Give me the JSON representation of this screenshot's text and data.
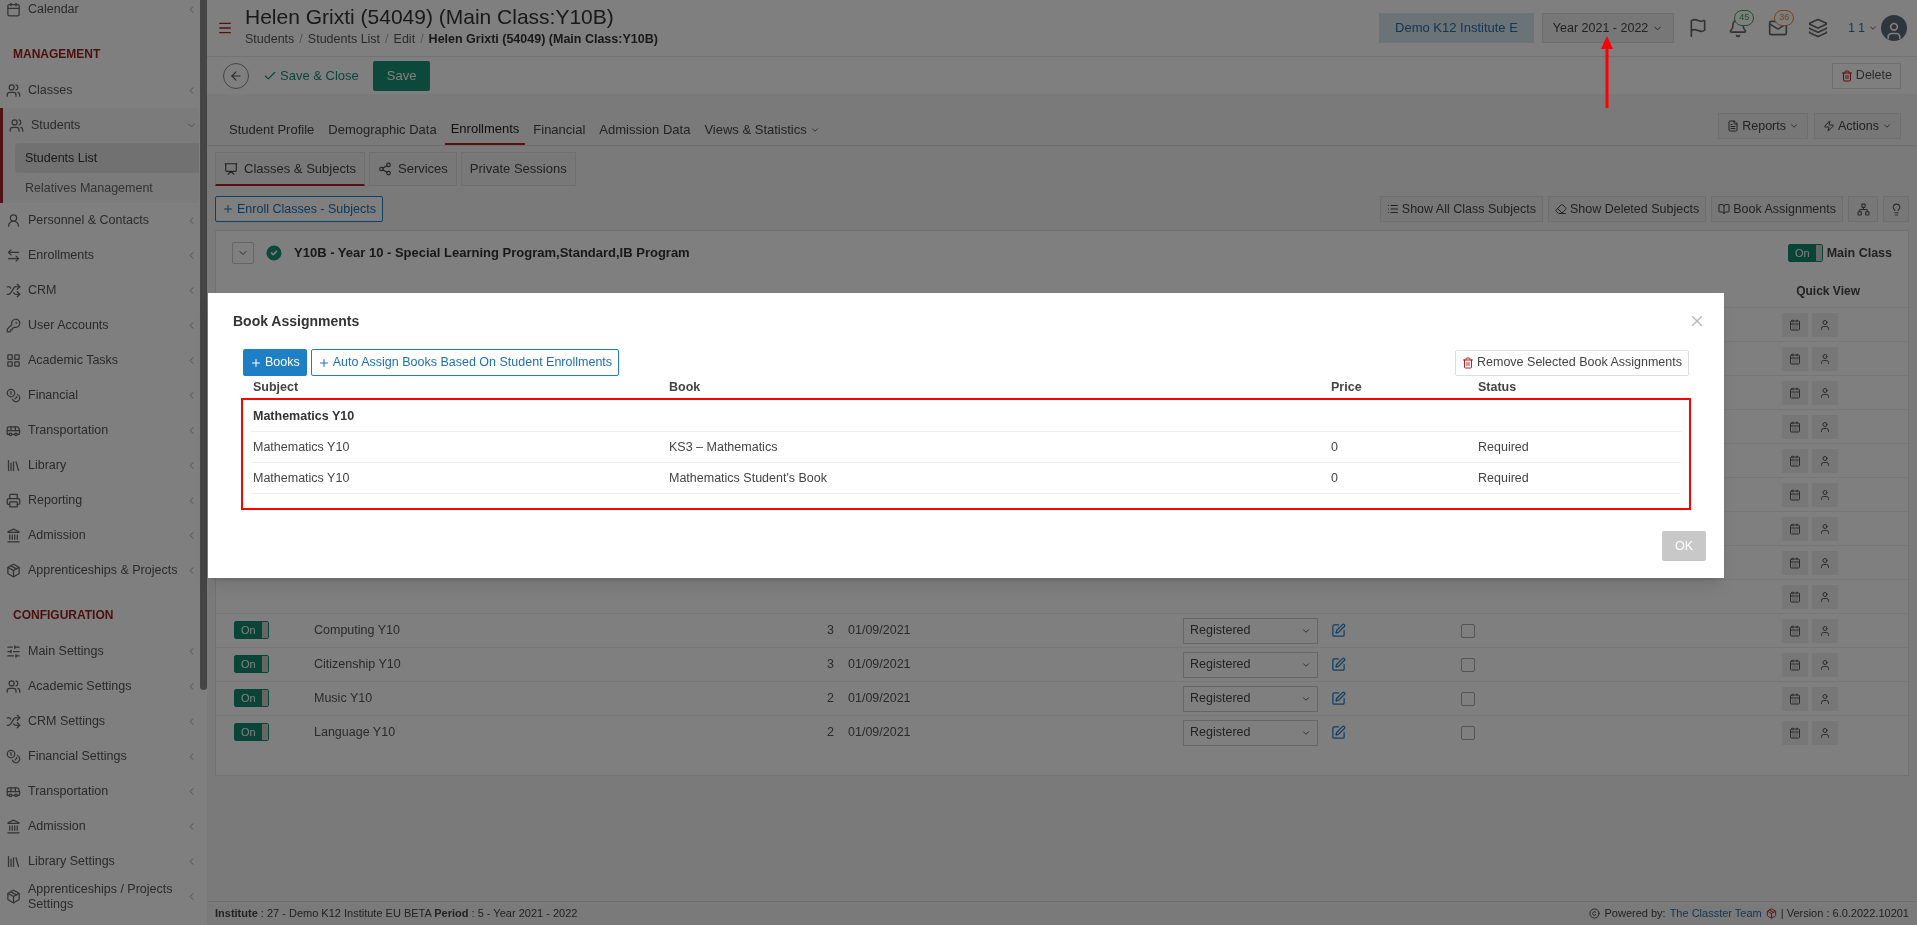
{
  "sidebar": {
    "items": [
      {
        "kind": "item",
        "label": "Calendar",
        "expanded": false
      },
      {
        "kind": "section",
        "label": "MANAGEMENT"
      },
      {
        "kind": "item",
        "label": "Classes",
        "expanded": false
      },
      {
        "kind": "item",
        "label": "Students",
        "expanded": true,
        "children": [
          {
            "label": "Students List",
            "selected": true
          },
          {
            "label": "Relatives Management",
            "selected": false
          }
        ]
      },
      {
        "kind": "item",
        "label": "Personnel & Contacts",
        "expanded": false
      },
      {
        "kind": "item",
        "label": "Enrollments",
        "expanded": false
      },
      {
        "kind": "item",
        "label": "CRM",
        "expanded": false
      },
      {
        "kind": "item",
        "label": "User Accounts",
        "expanded": false
      },
      {
        "kind": "item",
        "label": "Academic Tasks",
        "expanded": false
      },
      {
        "kind": "item",
        "label": "Financial",
        "expanded": false
      },
      {
        "kind": "item",
        "label": "Transportation",
        "expanded": false
      },
      {
        "kind": "item",
        "label": "Library",
        "expanded": false
      },
      {
        "kind": "item",
        "label": "Reporting",
        "expanded": false
      },
      {
        "kind": "item",
        "label": "Admission",
        "expanded": false
      },
      {
        "kind": "item",
        "label": "Apprenticeships & Projects",
        "expanded": false
      },
      {
        "kind": "section",
        "label": "CONFIGURATION"
      },
      {
        "kind": "item",
        "label": "Main Settings",
        "expanded": false
      },
      {
        "kind": "item",
        "label": "Academic Settings",
        "expanded": false
      },
      {
        "kind": "item",
        "label": "CRM Settings",
        "expanded": false
      },
      {
        "kind": "item",
        "label": "Financial Settings",
        "expanded": false
      },
      {
        "kind": "item",
        "label": "Transportation",
        "expanded": false
      },
      {
        "kind": "item",
        "label": "Admission",
        "expanded": false
      },
      {
        "kind": "item",
        "label": "Library Settings",
        "expanded": false
      },
      {
        "kind": "item",
        "label": "Apprenticeships / Projects Settings",
        "expanded": false
      }
    ]
  },
  "header": {
    "title": "Helen Grixti (54049) (Main Class:Y10B)",
    "breadcrumb_separator": "/",
    "breadcrumb": [
      {
        "label": "Students",
        "current": false
      },
      {
        "label": "Students List",
        "current": false
      },
      {
        "label": "Edit",
        "current": false
      },
      {
        "label": "Helen Grixti (54049) (Main Class:Y10B)",
        "current": true
      }
    ],
    "institute": "Demo K12 Institute E",
    "year": "Year 2021 - 2022",
    "icons": [
      {
        "kind": "flag"
      },
      {
        "kind": "bell",
        "badge": "45"
      },
      {
        "kind": "mail",
        "badge": "36"
      },
      {
        "kind": "layers"
      }
    ],
    "user": "1 1"
  },
  "toolbar": {
    "save_close": "Save & Close",
    "save": "Save",
    "delete": "Delete"
  },
  "tabs": [
    {
      "label": "Student Profile",
      "selected": false
    },
    {
      "label": "Demographic Data",
      "selected": false
    },
    {
      "label": "Enrollments",
      "selected": true
    },
    {
      "label": "Financial",
      "selected": false
    },
    {
      "label": "Admission Data",
      "selected": false
    },
    {
      "label": "Views & Statistics",
      "selected": false,
      "dropdown": true
    }
  ],
  "tab_actions": [
    "Reports",
    "Actions"
  ],
  "subtabs": [
    {
      "label": "Classes & Subjects",
      "selected": true
    },
    {
      "label": "Services",
      "selected": false
    },
    {
      "label": "Private Sessions",
      "selected": false
    }
  ],
  "action_bar": {
    "enroll": "Enroll Classes - Subjects",
    "buttons": [
      "Show All Class Subjects",
      "Show Deleted Subjects",
      "Book Assignments"
    ]
  },
  "class_panel": {
    "title": "Y10B - Year 10 - Special Learning Program,Standard,IB Program",
    "main_toggle": {
      "on": true,
      "label": "On"
    },
    "main_label": "Main Class",
    "quick_view": "Quick View",
    "rows": [
      {
        "on": true,
        "toggle": "On",
        "subject": "Computing Y10",
        "hours": "3",
        "date": "01/09/2021",
        "status": "Registered",
        "checked": false
      },
      {
        "on": true,
        "toggle": "On",
        "subject": "Citizenship Y10",
        "hours": "3",
        "date": "01/09/2021",
        "status": "Registered",
        "checked": false
      },
      {
        "on": true,
        "toggle": "On",
        "subject": "Music Y10",
        "hours": "2",
        "date": "01/09/2021",
        "status": "Registered",
        "checked": false
      },
      {
        "on": true,
        "toggle": "On",
        "subject": "Language Y10",
        "hours": "2",
        "date": "01/09/2021",
        "status": "Registered",
        "checked": false
      }
    ]
  },
  "modal": {
    "title": "Book Assignments",
    "add_books": "Books",
    "auto_assign": "Auto Assign Books Based On Student Enrollments",
    "remove": "Remove Selected Book Assignments",
    "columns": [
      "Subject",
      "Book",
      "Price",
      "Status"
    ],
    "rows": [
      {
        "kind": "group",
        "subject": "Mathematics Y10"
      },
      {
        "kind": "book",
        "subject": "Mathematics Y10",
        "book": "KS3 – Mathematics",
        "price": "0",
        "status": "Required"
      },
      {
        "kind": "book",
        "subject": "Mathematics Y10",
        "book": "Mathematics Student's Book",
        "price": "0",
        "status": "Required"
      }
    ],
    "ok": {
      "label": "OK",
      "disabled": true
    }
  },
  "annotations": {
    "highlight_table": true,
    "arrow_to_year": true
  },
  "footer": {
    "info": "**Institute** : 27 - Demo K12 Institute EU BETA **Period** : 5 - Year 2021 - 2022",
    "powered": "Powered by:",
    "team": "The Classter Team",
    "version": "| Version : 6.0.2022.10201"
  }
}
